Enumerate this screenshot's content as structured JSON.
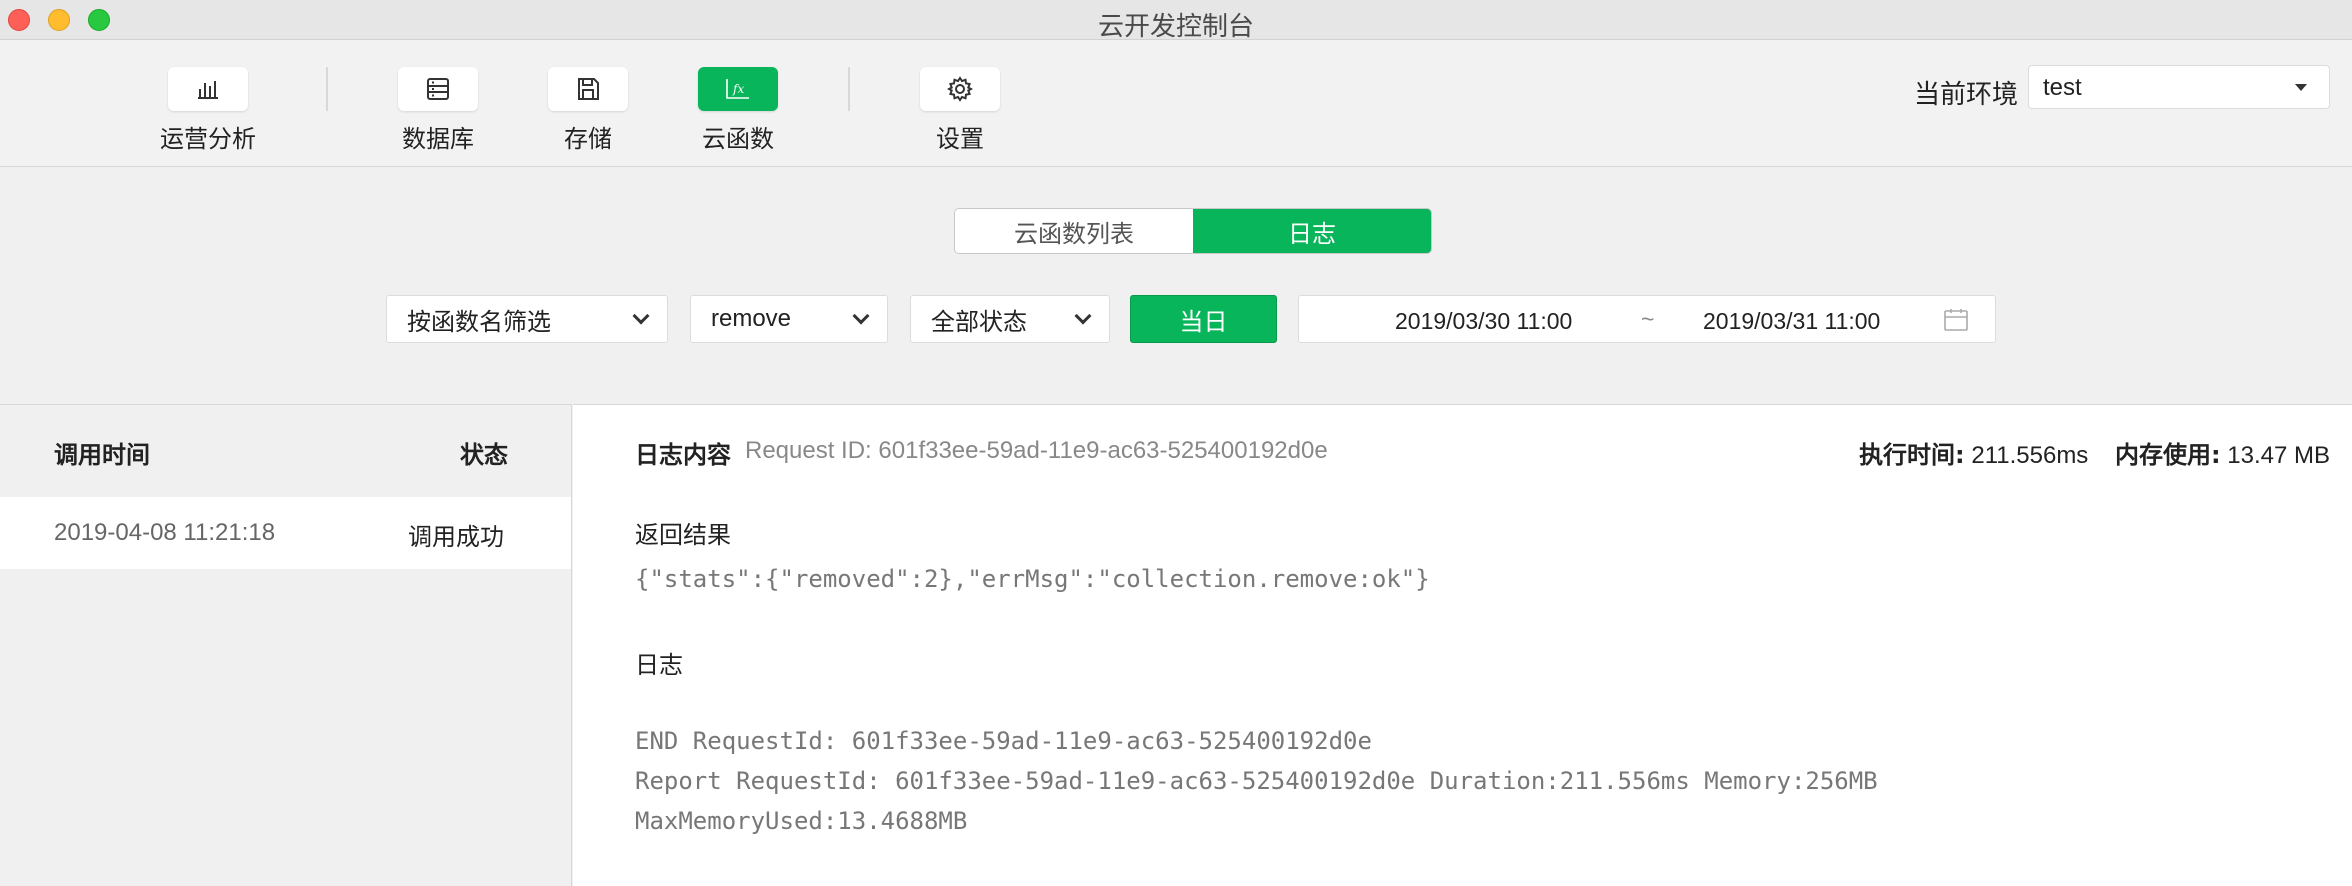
{
  "window": {
    "title": "云开发控制台"
  },
  "toolbar": {
    "items": [
      {
        "label": "运营分析",
        "icon": "bar-chart-icon"
      },
      {
        "label": "数据库",
        "icon": "database-icon"
      },
      {
        "label": "存储",
        "icon": "save-icon"
      },
      {
        "label": "云函数",
        "icon": "function-icon",
        "active": true
      },
      {
        "label": "设置",
        "icon": "gear-icon"
      }
    ],
    "env_label": "当前环境",
    "env_value": "test"
  },
  "tabs": {
    "list": "云函数列表",
    "logs": "日志",
    "active": "日志"
  },
  "filters": {
    "function_filter": "按函数名筛选",
    "function_name": "remove",
    "status": "全部状态",
    "today": "当日",
    "date_start": "2019/03/30 11:00",
    "date_sep": "~",
    "date_end": "2019/03/31 11:00"
  },
  "log_list": {
    "col_time": "调用时间",
    "col_status": "状态",
    "rows": [
      {
        "time": "2019-04-08 11:21:18",
        "status": "调用成功"
      }
    ]
  },
  "log_detail": {
    "title": "日志内容",
    "request_id": "Request ID: 601f33ee-59ad-11e9-ac63-525400192d0e",
    "exec_time_label": "执行时间:",
    "exec_time": "211.556ms",
    "mem_label": "内存使用:",
    "mem": "13.47 MB",
    "result_title": "返回结果",
    "result": "{\"stats\":{\"removed\":2},\"errMsg\":\"collection.remove:ok\"}",
    "log_title": "日志",
    "log_lines": [
      "END RequestId: 601f33ee-59ad-11e9-ac63-525400192d0e",
      "Report RequestId: 601f33ee-59ad-11e9-ac63-525400192d0e Duration:211.556ms Memory:256MB",
      "MaxMemoryUsed:13.4688MB"
    ]
  },
  "colors": {
    "accent": "#09b55a"
  }
}
